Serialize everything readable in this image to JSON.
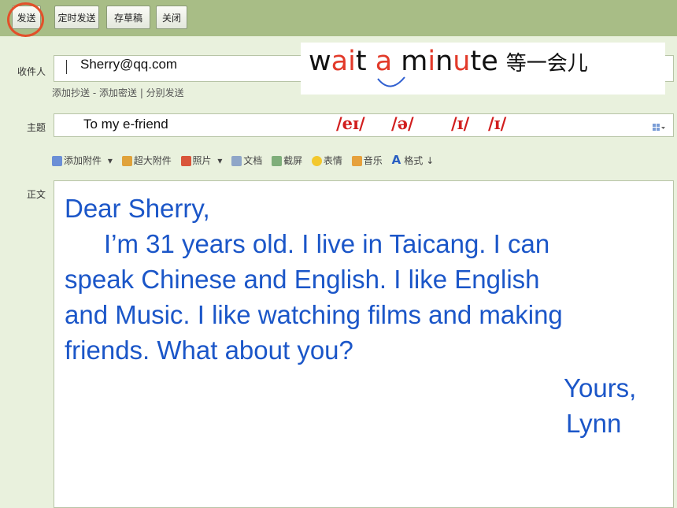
{
  "toolbar": {
    "send": "发送",
    "scheduled_send": "定时发送",
    "save_draft": "存草稿",
    "close": "关闭"
  },
  "recipient": {
    "label": "收件人",
    "value": "Sherry@qq.com",
    "links": [
      "添加抄送",
      "添加密送",
      "分别发送"
    ],
    "link_separators": [
      " - ",
      " | "
    ]
  },
  "subject": {
    "label": "主题",
    "value": "To my e-friend"
  },
  "phrase": {
    "text_parts": [
      "w",
      "ai",
      "t",
      " ",
      "a",
      " m",
      "i",
      "n",
      "u",
      "te"
    ],
    "chinese": "等一会儿",
    "ipa": [
      "/eɪ/",
      "/ə/",
      "/ɪ/",
      "/ɪ/"
    ],
    "highlight_color": "#e23a2a"
  },
  "attach_toolbar": {
    "items": [
      "添加附件",
      "超大附件",
      "照片",
      "文档",
      "截屏",
      "表情",
      "音乐",
      "格式"
    ]
  },
  "body": {
    "label": "正文",
    "lines": [
      "Dear Sherry,",
      "I’m 31 years old. I live in Taicang. I can",
      "speak Chinese and English. I like English",
      "and Music. I like watching films and making",
      "friends. What about you?",
      "Yours,",
      "Lynn"
    ],
    "text_color": "#1b56c8"
  },
  "colors": {
    "topbar": "#a8bd86",
    "background": "#e9f1dd",
    "circle": "#e2502a"
  }
}
